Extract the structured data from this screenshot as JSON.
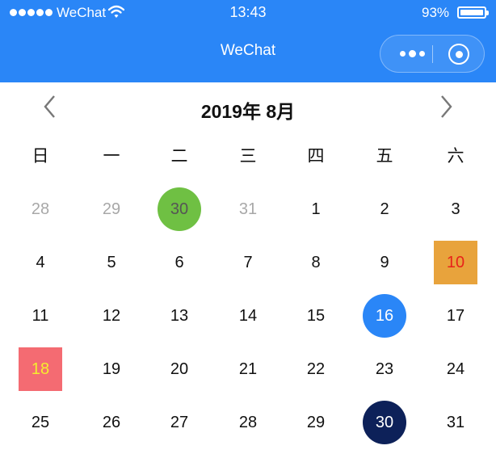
{
  "status_bar": {
    "carrier": "WeChat",
    "time": "13:43",
    "battery_percent": "93%"
  },
  "nav": {
    "title": "WeChat"
  },
  "calendar": {
    "month_title": "2019年 8月",
    "weekdays": [
      "日",
      "一",
      "二",
      "三",
      "四",
      "五",
      "六"
    ],
    "weeks": [
      [
        {
          "label": "28",
          "outside_month": true
        },
        {
          "label": "29",
          "outside_month": true
        },
        {
          "label": "30",
          "outside_month": true,
          "bg": "#6fc043",
          "shape": "circle",
          "text_color": "#555555"
        },
        {
          "label": "31",
          "outside_month": true
        },
        {
          "label": "1"
        },
        {
          "label": "2"
        },
        {
          "label": "3"
        }
      ],
      [
        {
          "label": "4"
        },
        {
          "label": "5"
        },
        {
          "label": "6"
        },
        {
          "label": "7"
        },
        {
          "label": "8"
        },
        {
          "label": "9"
        },
        {
          "label": "10",
          "bg": "#e8a33c",
          "shape": "square",
          "text_color": "#e8231a"
        }
      ],
      [
        {
          "label": "11"
        },
        {
          "label": "12"
        },
        {
          "label": "13"
        },
        {
          "label": "14"
        },
        {
          "label": "15"
        },
        {
          "label": "16",
          "bg": "#2a86f7",
          "shape": "circle",
          "text_color": "#ffffff"
        },
        {
          "label": "17"
        }
      ],
      [
        {
          "label": "18",
          "bg": "#f46b72",
          "shape": "square",
          "text_color": "#f5ee2e"
        },
        {
          "label": "19"
        },
        {
          "label": "20"
        },
        {
          "label": "21"
        },
        {
          "label": "22"
        },
        {
          "label": "23"
        },
        {
          "label": "24"
        }
      ],
      [
        {
          "label": "25"
        },
        {
          "label": "26"
        },
        {
          "label": "27"
        },
        {
          "label": "28"
        },
        {
          "label": "29"
        },
        {
          "label": "30",
          "bg": "#0d2159",
          "shape": "circle",
          "text_color": "#ffffff"
        },
        {
          "label": "31"
        }
      ]
    ]
  },
  "colors": {
    "header_bg": "#2a86f7",
    "outside_month_text": "#a8a8a8"
  },
  "icons": {
    "signal": "signal-dots-icon",
    "wifi": "wifi-icon",
    "battery": "battery-icon",
    "more": "more-dots-icon",
    "close": "close-circle-icon",
    "prev": "chevron-left-icon",
    "next": "chevron-right-icon"
  }
}
